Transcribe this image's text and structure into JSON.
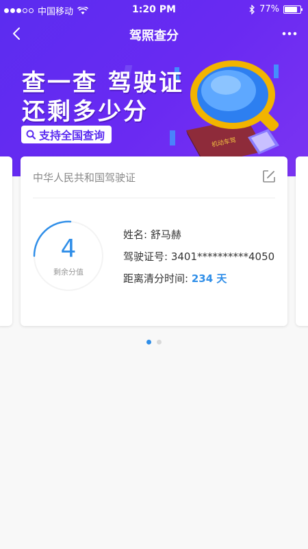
{
  "status": {
    "carrier": "中国移动",
    "time": "1:20 PM",
    "battery": "77%",
    "battery_level": 0.77
  },
  "nav": {
    "title": "驾照查分"
  },
  "banner": {
    "line1": "查一查 驾驶证",
    "line2": "还剩多少分",
    "search_text": "支持全国查询",
    "book_text": "机动车驾"
  },
  "card": {
    "title": "中华人民共和国驾驶证",
    "score": "4",
    "score_label": "剩余分值",
    "name_label": "姓名:",
    "name_value": "舒马赫",
    "license_label": "驾驶证号:",
    "license_value": "3401**********4050",
    "clear_label": "距离清分时间:",
    "clear_value": "234 天"
  },
  "pager": {
    "count": 2,
    "active": 0
  },
  "colors": {
    "purple": "#5b2cf0",
    "accent_blue": "#2f8ee8"
  }
}
